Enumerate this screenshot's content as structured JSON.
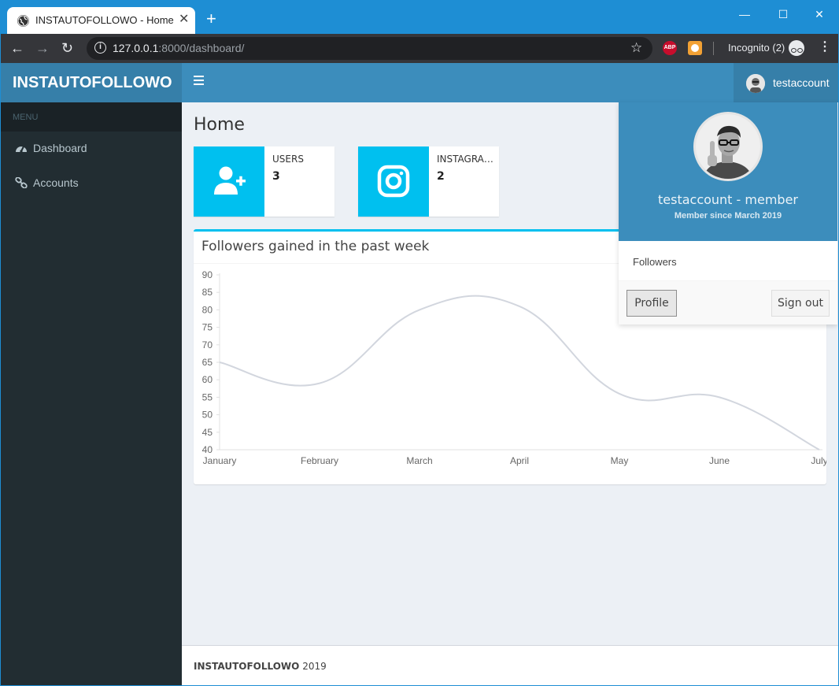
{
  "browser": {
    "tab_title": "INSTAUTOFOLLOWO - Home",
    "tab_close": "✕",
    "new_tab": "+",
    "url_host": "127.0.0.1",
    "url_rest": ":8000/dashboard/",
    "incognito_label": "Incognito (2)",
    "ext_abp": "ABP"
  },
  "header": {
    "logo": "INSTAUTOFOLLOWO",
    "user_name": "testaccount"
  },
  "sidebar": {
    "menu_header": "MENU",
    "items": [
      {
        "label": "Dashboard",
        "icon": "dashboard-icon"
      },
      {
        "label": "Accounts",
        "icon": "link-icon"
      }
    ]
  },
  "main": {
    "page_title": "Home",
    "infoboxes": [
      {
        "label": "USERS",
        "value": "3",
        "icon": "user-plus-icon"
      },
      {
        "label": "INSTAGRAM ACCOUNTS",
        "value": "2",
        "icon": "instagram-icon"
      }
    ],
    "chart_box_title": "Followers gained in the past week"
  },
  "chart_data": {
    "type": "line",
    "categories": [
      "January",
      "February",
      "March",
      "April",
      "May",
      "June",
      "July"
    ],
    "values": [
      65,
      59,
      80,
      81,
      56,
      55,
      40
    ],
    "title": "Followers gained in the past week",
    "ylim": [
      40,
      90
    ],
    "yticks": [
      90,
      85,
      80,
      75,
      70,
      65,
      60,
      55,
      50,
      45,
      40
    ],
    "line_color": "#d2d6de",
    "grid": false
  },
  "dropdown": {
    "user_title": "testaccount - member",
    "member_since": "Member since March 2019",
    "body_link": "Followers",
    "profile_btn": "Profile",
    "signout_btn": "Sign out"
  },
  "footer": {
    "brand": "INSTAUTOFOLLOWO",
    "year": "2019"
  },
  "colors": {
    "accent": "#3c8dbc",
    "accent_dark": "#367fa9",
    "sidebar": "#222d32",
    "infobox_aqua": "#00c0ef"
  }
}
